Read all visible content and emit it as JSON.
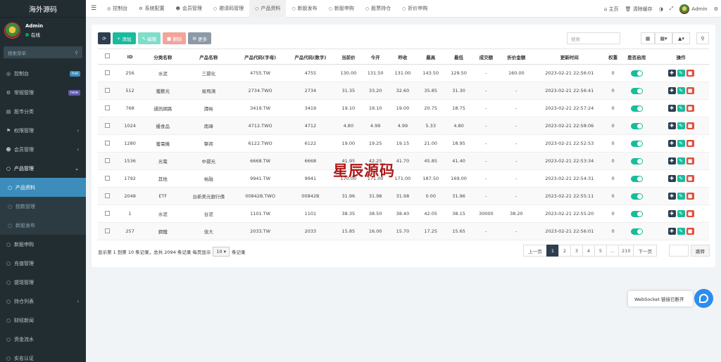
{
  "sidebar": {
    "brand": "海外源码",
    "user": {
      "name": "Admin",
      "status": "在线"
    },
    "search_placeholder": "搜索菜单",
    "items": [
      {
        "label": "控制台",
        "icon": "dashboard-icon",
        "glyph": "◎",
        "badge": "hot",
        "badge_color": "#3c8dbc"
      },
      {
        "label": "常规管理",
        "icon": "cogs-icon",
        "glyph": "⚙",
        "badge": "new",
        "badge_color": "#605ca8"
      },
      {
        "label": "股市分类",
        "icon": "list-icon",
        "glyph": "▤"
      },
      {
        "label": "权限管理",
        "icon": "group-icon",
        "glyph": "⚑",
        "arrow": "‹"
      },
      {
        "label": "会员管理",
        "icon": "user-icon",
        "glyph": "☻",
        "arrow": "‹"
      },
      {
        "label": "产品管理",
        "icon": "circle-icon",
        "glyph": "○",
        "arrow": "⌄"
      }
    ],
    "sub_items": [
      {
        "label": "产品资料",
        "active": true
      },
      {
        "label": "指数管理"
      },
      {
        "label": "新股发布"
      }
    ],
    "items_after": [
      {
        "label": "新股申购",
        "icon": "circle-icon",
        "glyph": "○"
      },
      {
        "label": "充值管理",
        "icon": "circle-icon",
        "glyph": "○"
      },
      {
        "label": "提现管理",
        "icon": "circle-icon",
        "glyph": "○"
      },
      {
        "label": "持仓列表",
        "icon": "circle-icon",
        "glyph": "○",
        "arrow": "‹"
      },
      {
        "label": "财经新闻",
        "icon": "circle-icon",
        "glyph": "○"
      },
      {
        "label": "资金流水",
        "icon": "circle-icon",
        "glyph": "○"
      },
      {
        "label": "实名认证",
        "icon": "circle-icon",
        "glyph": "○"
      }
    ]
  },
  "topnav": {
    "tabs": [
      {
        "label": "控制台",
        "icon": "dashboard-icon",
        "glyph": "◎"
      },
      {
        "label": "系统配置",
        "icon": "cog-icon",
        "glyph": "⚙"
      },
      {
        "label": "会员管理",
        "icon": "user-icon",
        "glyph": "☻"
      },
      {
        "label": "邀请码管理",
        "icon": "circle-icon",
        "glyph": "○"
      },
      {
        "label": "产品资料",
        "icon": "circle-icon",
        "glyph": "○",
        "active": true
      },
      {
        "label": "新股发布",
        "icon": "circle-icon",
        "glyph": "○"
      },
      {
        "label": "新股申购",
        "icon": "circle-icon",
        "glyph": "○"
      },
      {
        "label": "股票持仓",
        "icon": "circle-icon",
        "glyph": "○"
      },
      {
        "label": "折价申购",
        "icon": "circle-icon",
        "glyph": "○"
      }
    ],
    "home": "主页",
    "clear_cache": "清除缓存",
    "admin": "Admin"
  },
  "toolbar": {
    "add": "添加",
    "edit": "编辑",
    "delete": "删除",
    "more": "更多",
    "search_placeholder": "搜索"
  },
  "table": {
    "headers": [
      "",
      "ID",
      "分类名称",
      "产品名称",
      "产品代码(字母)",
      "产品代码(数字)",
      "当前价",
      "今开",
      "昨收",
      "最高",
      "最低",
      "成交额",
      "折价金额",
      "更新时间",
      "权重",
      "是否启用",
      "操作"
    ],
    "rows": [
      [
        "256",
        "水泥",
        "三揚化",
        "4755.TW",
        "4755",
        "130.00",
        "131.50",
        "131.00",
        "143.50",
        "129.50",
        "-",
        "160.00",
        "2023-02-21 22:56:01",
        "0"
      ],
      [
        "512",
        "獲獸光",
        "易飛鴻",
        "2734.TWO",
        "2734",
        "31.35",
        "33.20",
        "32.60",
        "35.85",
        "31.30",
        "-",
        "-",
        "2023-02-21 22:56:41",
        "0"
      ],
      [
        "768",
        "通訊網路",
        "譚裕",
        "3419.TW",
        "3419",
        "19.10",
        "19.10",
        "19.00",
        "20.75",
        "18.75",
        "-",
        "-",
        "2023-02-21 22:57:24",
        "0"
      ],
      [
        "1024",
        "擾食品",
        "南璋",
        "4712.TWO",
        "4712",
        "4.80",
        "4.99",
        "4.99",
        "5.33",
        "4.80",
        "-",
        "-",
        "2023-02-21 22:58:06",
        "0"
      ],
      [
        "1280",
        "獲電機",
        "擎邦",
        "6122.TWO",
        "6122",
        "19.00",
        "19.25",
        "19.15",
        "21.00",
        "18.95",
        "-",
        "-",
        "2023-02-21 22:52:53",
        "0"
      ],
      [
        "1536",
        "光電",
        "中揚光",
        "6668.TW",
        "6668",
        "41.95",
        "42.25",
        "41.70",
        "45.85",
        "41.40",
        "-",
        "-",
        "2023-02-21 22:53:34",
        "0"
      ],
      [
        "1792",
        "其他",
        "裕融",
        "9941.TW",
        "9941",
        "170.00",
        "171.00",
        "171.00",
        "187.50",
        "169.00",
        "-",
        "-",
        "2023-02-21 22:54:31",
        "0"
      ],
      [
        "2048",
        "ETF",
        "台新美元銀行債",
        "00842B.TWO",
        "00842B",
        "31.96",
        "31.98",
        "31.98",
        "0.00",
        "31.96",
        "-",
        "-",
        "2023-02-21 22:55:11",
        "0"
      ],
      [
        "1",
        "水泥",
        "台泥",
        "1101.TW",
        "1101",
        "38.35",
        "38.50",
        "38.40",
        "42.05",
        "38.15",
        "30000",
        "38.20",
        "2023-02-21 22:55:20",
        "0"
      ],
      [
        "257",
        "鋼鐵",
        "佳大",
        "2033.TW",
        "2033",
        "15.85",
        "16.00",
        "15.70",
        "17.25",
        "15.65",
        "-",
        "-",
        "2023-02-21 22:56:01",
        "0"
      ]
    ]
  },
  "footer": {
    "info_prefix": "显示第 1 到第 10 条记录，总共 2094 条记录 每页显示",
    "page_size": "10",
    "info_suffix": "条记录"
  },
  "pager": {
    "prev": "上一页",
    "pages": [
      "1",
      "2",
      "3",
      "4",
      "5",
      "...",
      "210"
    ],
    "active_page": "1",
    "next": "下一页",
    "jump": "跳转"
  },
  "watermark": "星辰源码",
  "websocket_toast": "WebSocket 链接已断开",
  "colors": {
    "sidebar_bg": "#222d32",
    "accent": "#3c8dbc",
    "success": "#18bc9c",
    "danger": "#e74c3c",
    "dark": "#2c3e50"
  }
}
